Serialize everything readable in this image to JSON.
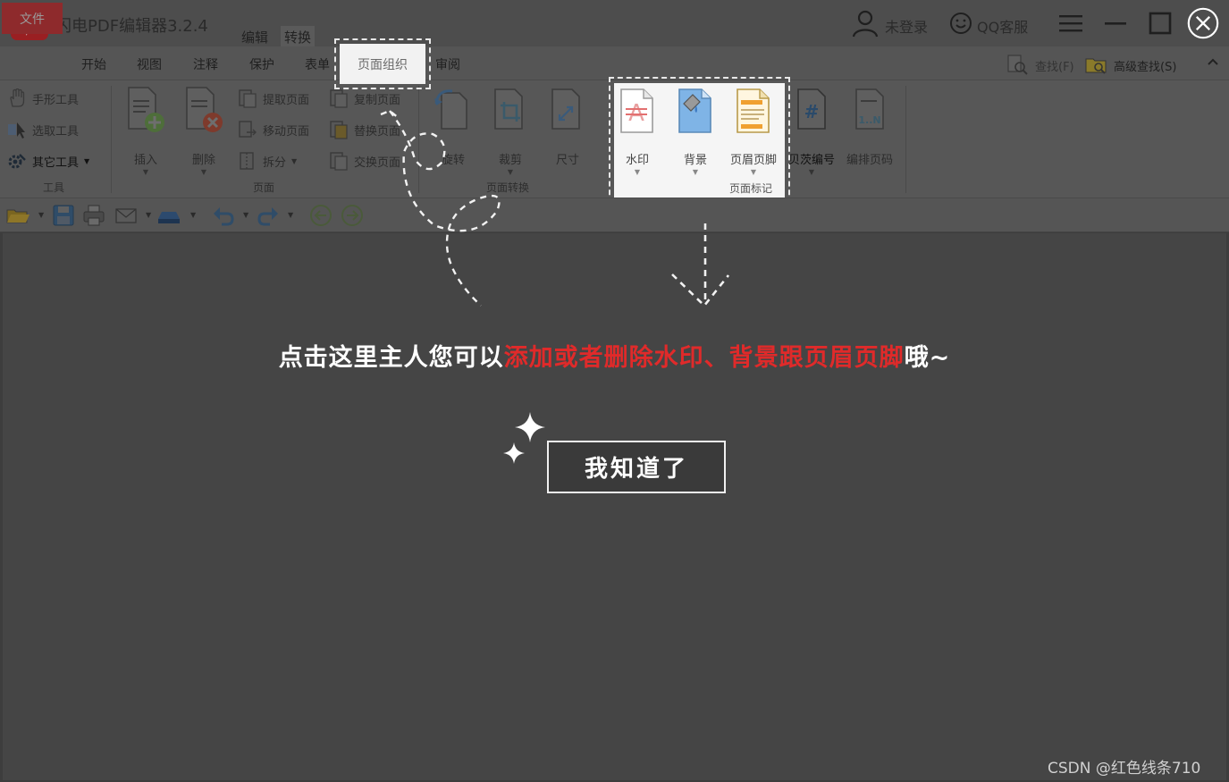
{
  "app": {
    "title": "闪电PDF编辑器3.2.4",
    "top_tabs": [
      "编辑",
      "转换"
    ]
  },
  "account": {
    "user_label": "未登录",
    "support_label": "QQ客服"
  },
  "ribbon_tabs": [
    "文件",
    "开始",
    "视图",
    "注释",
    "保护",
    "表单",
    "页面组织",
    "审阅"
  ],
  "active_tab": "页面组织",
  "search": {
    "find_label": "查找(F)",
    "advanced_find_label": "高级查找(S)"
  },
  "tools_group": {
    "label": "工具",
    "items": [
      "手形工具",
      "选取工具",
      "其它工具"
    ]
  },
  "page_group": {
    "label": "页面",
    "insert": "插入",
    "delete": "删除",
    "items": [
      "提取页面",
      "复制页面",
      "移动页面",
      "替换页面",
      "拆分",
      "交换页面"
    ]
  },
  "convert_group": {
    "label": "页面转换",
    "items": [
      "旋转",
      "裁剪",
      "尺寸"
    ]
  },
  "mark_group": {
    "label": "页面标记",
    "items": [
      "水印",
      "背景",
      "页眉页脚"
    ]
  },
  "numbering": {
    "items": [
      "贝茨编号",
      "编排页码"
    ]
  },
  "guide": {
    "text_before": "点击这里主人您可以",
    "text_highlight": "添加或者删除水印、背景跟页眉页脚",
    "text_after": "哦~",
    "button_label": "我知道了",
    "highlight_color": "#e02a2a"
  },
  "watermark": "CSDN @红色线条710"
}
